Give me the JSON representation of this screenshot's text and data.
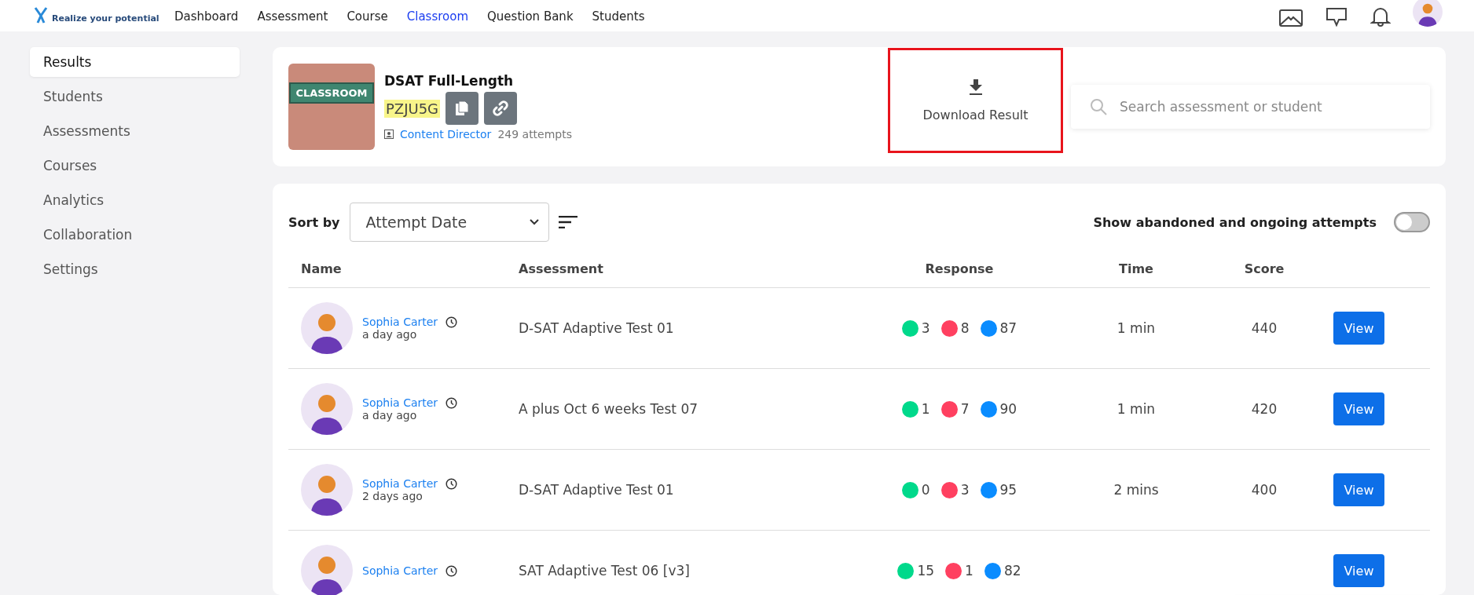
{
  "header": {
    "tagline": "Realize your potential",
    "nav": [
      {
        "label": "Dashboard",
        "selected": false
      },
      {
        "label": "Assessment",
        "selected": false
      },
      {
        "label": "Course",
        "selected": false
      },
      {
        "label": "Classroom",
        "selected": true
      },
      {
        "label": "Question Bank",
        "selected": false
      },
      {
        "label": "Students",
        "selected": false
      }
    ]
  },
  "sidebar": {
    "items": [
      {
        "label": "Results",
        "selected": true
      },
      {
        "label": "Students",
        "selected": false
      },
      {
        "label": "Assessments",
        "selected": false
      },
      {
        "label": "Courses",
        "selected": false
      },
      {
        "label": "Analytics",
        "selected": false
      },
      {
        "label": "Collaboration",
        "selected": false
      },
      {
        "label": "Settings",
        "selected": false
      }
    ]
  },
  "classroom": {
    "thumbnail_label": "CLASSROOM",
    "title": "DSAT Full-Length",
    "code": "PZJU5G",
    "owner": "Content Director",
    "attempts": "249 attempts"
  },
  "download": {
    "label": "Download Result"
  },
  "search": {
    "placeholder": "Search assessment or student"
  },
  "sort": {
    "label": "Sort by",
    "value": "Attempt Date"
  },
  "toggle": {
    "label": "Show abandoned and ongoing attempts",
    "on": false
  },
  "table": {
    "columns": [
      "Name",
      "Assessment",
      "Response",
      "Time",
      "Score"
    ],
    "rows": [
      {
        "name": "Sophia Carter",
        "when": "a day ago",
        "assessment": "D-SAT Adaptive Test 01",
        "correct": "3",
        "wrong": "8",
        "skipped": "87",
        "time": "1 min",
        "score": "440",
        "action": "View"
      },
      {
        "name": "Sophia Carter",
        "when": "a day ago",
        "assessment": "A plus Oct 6 weeks Test 07",
        "correct": "1",
        "wrong": "7",
        "skipped": "90",
        "time": "1 min",
        "score": "420",
        "action": "View"
      },
      {
        "name": "Sophia Carter",
        "when": "2 days ago",
        "assessment": "D-SAT Adaptive Test 01",
        "correct": "0",
        "wrong": "3",
        "skipped": "95",
        "time": "2 mins",
        "score": "400",
        "action": "View"
      },
      {
        "name": "Sophia Carter",
        "assessment": "SAT Adaptive Test 06 [v3]",
        "correct": "15",
        "wrong": "1",
        "skipped": "82",
        "action": "View"
      }
    ]
  }
}
